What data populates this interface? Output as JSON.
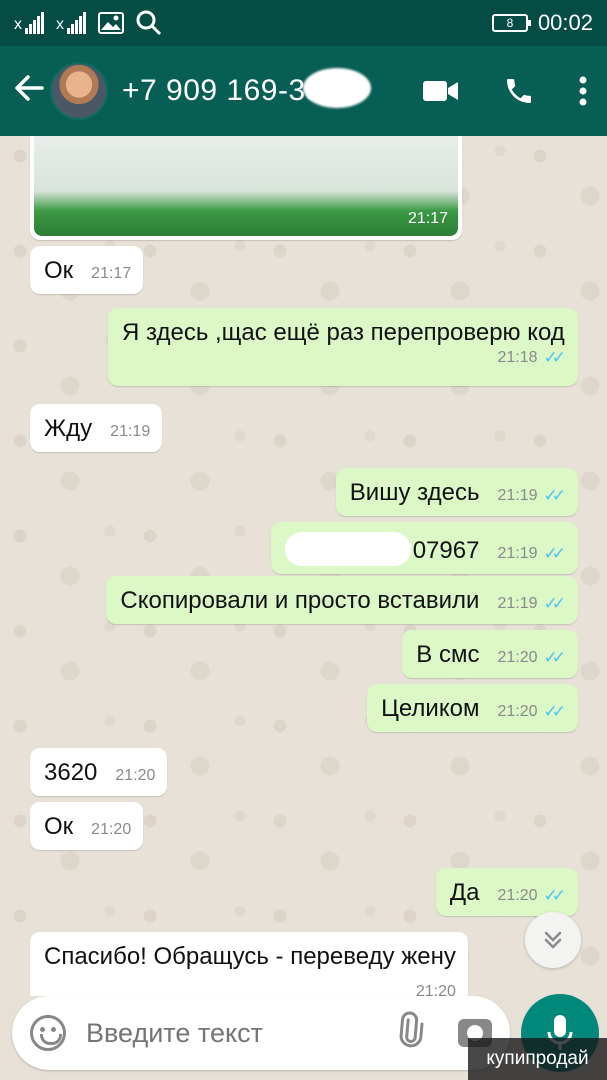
{
  "status_bar": {
    "sim1": "x",
    "sim2": "x",
    "battery": "8",
    "time": "00:02"
  },
  "header": {
    "contact": "+7 909 169-33-"
  },
  "messages": [
    {
      "type": "in",
      "text": "Ок",
      "time": "21:17"
    },
    {
      "type": "out",
      "text": "Я здесь ,щас ещё раз перепроверю код",
      "time": "21:18"
    },
    {
      "type": "in",
      "text": "Жду",
      "time": "21:19"
    },
    {
      "type": "out",
      "text": "Вишу здесь",
      "time": "21:19"
    },
    {
      "type": "out",
      "text": "07967",
      "time": "21:19"
    },
    {
      "type": "out",
      "text": "Скопировали и просто вставили",
      "time": "21:19"
    },
    {
      "type": "out",
      "text": "В смс",
      "time": "21:20"
    },
    {
      "type": "out",
      "text": "Целиком",
      "time": "21:20"
    },
    {
      "type": "in",
      "text": "3620",
      "time": "21:20"
    },
    {
      "type": "in",
      "text": "Ок",
      "time": "21:20"
    },
    {
      "type": "out",
      "text": "Да",
      "time": "21:20"
    },
    {
      "type": "in",
      "text": "Спасибо! Обращусь - переведу жену",
      "time": "21:20"
    }
  ],
  "image_message": {
    "time": "21:17"
  },
  "input": {
    "placeholder": "Введите текст"
  },
  "watermark": "купипродай",
  "colors": {
    "header": "#075e54",
    "status_bar": "#054c44",
    "outgoing_bubble": "#dcf8c6",
    "incoming_bubble": "#ffffff",
    "read_ticks": "#4fc3f7",
    "mic_button": "#00897b"
  },
  "icons": [
    "back-arrow-icon",
    "video-call-icon",
    "phone-icon",
    "more-vert-icon",
    "emoji-icon",
    "attach-icon",
    "camera-icon",
    "mic-icon",
    "chevron-double-down-icon"
  ]
}
